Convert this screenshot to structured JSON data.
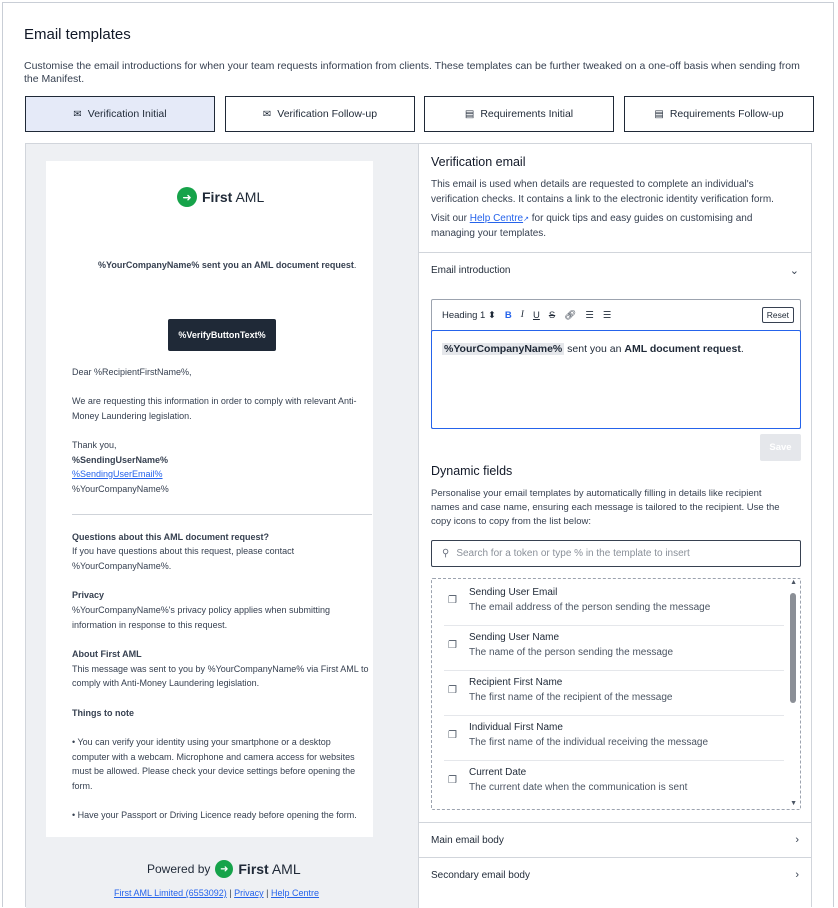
{
  "header": {
    "title": "Email templates",
    "description": "Customise the email introductions for when your team requests information from clients. These templates can be further tweaked on a one-off basis when sending from the Manifest."
  },
  "tabs": [
    {
      "label": "Verification Initial",
      "icon": "envelope-icon",
      "active": true
    },
    {
      "label": "Verification Follow-up",
      "icon": "envelope-icon",
      "active": false
    },
    {
      "label": "Requirements Initial",
      "icon": "document-icon",
      "active": false
    },
    {
      "label": "Requirements Follow-up",
      "icon": "document-icon",
      "active": false
    }
  ],
  "preview": {
    "logo_bold": "First",
    "logo_light": "AML",
    "headline_pre": "%YourCompanyName% sent you an ",
    "headline_bold": "AML document request",
    "headline_post": ".",
    "button_label": "%VerifyButtonText%",
    "greeting": "Dear %RecipientFirstName%,",
    "body_line1": "We are requesting this information in order to comply with relevant Anti-",
    "body_line2": "Money Laundering legislation.",
    "thanks": "Thank you,",
    "sender_name": "%SendingUserName%",
    "sender_email": "%SendingUserEmail%",
    "company": "%YourCompanyName%",
    "questions_title": "Questions about this AML document request?",
    "questions_line1": "If you have questions about this request, please contact",
    "questions_line2": "%YourCompanyName%.",
    "privacy_title": "Privacy",
    "privacy_line1": "%YourCompanyName%'s privacy policy applies when submitting",
    "privacy_line2": "information in response to this request.",
    "about_title": "About First AML",
    "about_line1": "This message was sent to you by %YourCompanyName% via First AML to",
    "about_line2": "comply with Anti-Money Laundering legislation.",
    "things_title": "Things to note",
    "note1_line1": "• You can verify your identity using your smartphone or a desktop",
    "note1_line2": "computer with a webcam. Microphone and camera access for websites",
    "note1_line3": "must be allowed. Please check your device settings before opening the",
    "note1_line4": "form.",
    "note2": "• Have your Passport or Driving Licence ready before opening the form.",
    "powered_by": "Powered by",
    "footer_company": "First AML Limited (6553092)",
    "footer_sep": "|",
    "footer_privacy": "Privacy",
    "footer_help": "Help Centre"
  },
  "editor_panel": {
    "title": "Verification email",
    "desc_line1": "This email is used when details are requested to complete an individual's",
    "desc_line2": "verification checks. It contains a link to the electronic identity verification form.",
    "visit_pre": "Visit our ",
    "help_link": "Help Centre",
    "visit_post": " for quick tips and easy guides on customising and",
    "visit_line2": "managing your templates.",
    "section_intro": "Email introduction",
    "heading_select": "Heading 1",
    "reset_label": "Reset",
    "content_token": "%YourCompanyName%",
    "content_mid": " sent you an ",
    "content_bold": "AML document request",
    "content_end": ".",
    "save_label": "Save",
    "dynamic_title": "Dynamic fields",
    "dynamic_line1": "Personalise your email templates by automatically filling in details like recipient",
    "dynamic_line2": "names and case name, ensuring each message is tailored to the recipient. Use the",
    "dynamic_line3": "copy icons to copy from the list below:",
    "search_placeholder": "Search for a token or type % in the template to insert",
    "tokens": [
      {
        "name": "Sending User Email",
        "desc": "The email address of the person sending the message"
      },
      {
        "name": "Sending User Name",
        "desc": "The name of the person sending the message"
      },
      {
        "name": "Recipient First Name",
        "desc": "The first name of the recipient of the message"
      },
      {
        "name": "Individual First Name",
        "desc": "The first name of the individual receiving the message"
      },
      {
        "name": "Current Date",
        "desc": "The current date when the communication is sent"
      }
    ],
    "section_main": "Main email body",
    "section_secondary": "Secondary email body"
  },
  "colors": {
    "accent": "#2563eb",
    "brand_green": "#16a34a",
    "active_tab": "#e5eaf8"
  }
}
